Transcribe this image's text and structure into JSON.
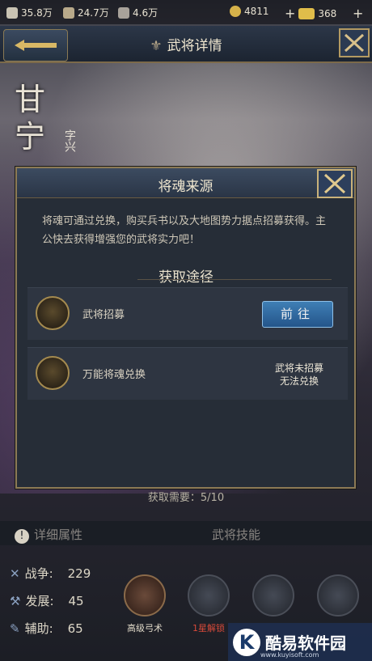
{
  "resources": {
    "fight_power": "35.8万",
    "troops": "24.7万",
    "food": "4.6万",
    "copper": "4811",
    "gold": "368"
  },
  "header": {
    "title": "武将详情"
  },
  "hero": {
    "name": "甘宁",
    "courtesy": "字兴"
  },
  "modal": {
    "title": "将魂来源",
    "description": "将魂可通过兑换，购买兵书以及大地图势力据点招募获得。主公快去获得增强您的武将实力吧！",
    "section_title": "获取途径",
    "routes": [
      {
        "label": "武将招募",
        "action": "前往"
      },
      {
        "label": "万能将魂兑换",
        "status_line1": "武将未招募",
        "status_line2": "无法兑换"
      }
    ]
  },
  "progress": {
    "text": "获取需要：5/10"
  },
  "tabs": {
    "attributes": "详细属性",
    "skills": "武将技能"
  },
  "stats": [
    {
      "label": "战争:",
      "value": "229"
    },
    {
      "label": "发展:",
      "value": "45"
    },
    {
      "label": "辅助:",
      "value": "65"
    }
  ],
  "skills": [
    {
      "label": "高级弓术"
    },
    {
      "label": "1星解锁"
    }
  ],
  "watermark": {
    "text": "酷易软件园",
    "url": "www.kuyisoft.com"
  }
}
